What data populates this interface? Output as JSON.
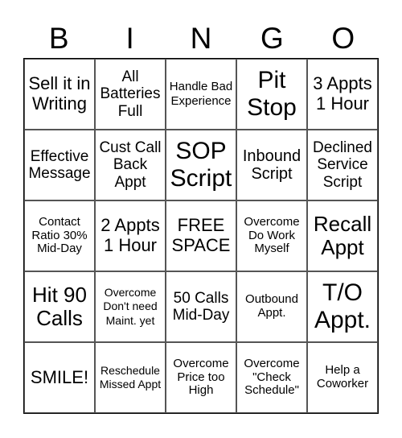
{
  "header": {
    "letters": [
      "B",
      "I",
      "N",
      "G",
      "O"
    ]
  },
  "board": {
    "rows": [
      [
        "Sell it in Writing",
        "All Batteries Full",
        "Handle Bad Experience",
        "Pit Stop",
        "3 Appts 1 Hour"
      ],
      [
        "Effective Message",
        "Cust Call Back Appt",
        "SOP Script",
        "Inbound Script",
        "Declined Service Script"
      ],
      [
        "Contact Ratio 30% Mid-Day",
        "2 Appts 1 Hour",
        "FREE SPACE",
        "Overcome Do Work Myself",
        "Recall Appt"
      ],
      [
        "Hit 90 Calls",
        "Overcome Don't need Maint. yet",
        "50 Calls Mid-Day",
        "Outbound Appt.",
        "T/O Appt."
      ],
      [
        "SMILE!",
        "Reschedule Missed Appt",
        "Overcome Price too High",
        "Overcome \"Check Schedule\"",
        "Help a Coworker"
      ]
    ]
  }
}
